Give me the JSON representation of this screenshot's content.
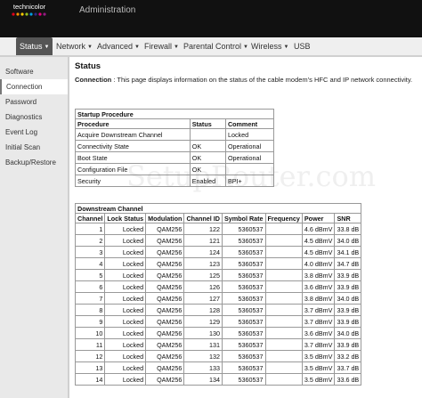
{
  "brand": {
    "logo_text": "technicolor",
    "watermark": "SetupRouter.com"
  },
  "header": {
    "title": "Administration"
  },
  "nav": {
    "items": [
      {
        "label": "Status",
        "caret": true
      },
      {
        "label": "Network",
        "caret": true
      },
      {
        "label": "Advanced",
        "caret": true
      },
      {
        "label": "Firewall",
        "caret": true
      },
      {
        "label": "Parental Control",
        "caret": true
      },
      {
        "label": "Wireless",
        "caret": true
      },
      {
        "label": "USB",
        "caret": false
      }
    ]
  },
  "sidebar": {
    "items": [
      "Software",
      "Connection",
      "Password",
      "Diagnostics",
      "Event Log",
      "Initial Scan",
      "Backup/Restore"
    ]
  },
  "main": {
    "title": "Status",
    "desc_label": "Connection",
    "desc_sep": ":",
    "desc_text": "This page displays information on the status of the cable modem's HFC and IP network connectivity."
  },
  "startup": {
    "caption": "Startup Procedure",
    "headers": [
      "Procedure",
      "Status",
      "Comment"
    ],
    "rows": [
      [
        "Acquire Downstream Channel",
        "",
        "Locked"
      ],
      [
        "Connectivity State",
        "OK",
        "Operational"
      ],
      [
        "Boot State",
        "OK",
        "Operational"
      ],
      [
        "Configuration File",
        "OK",
        ""
      ],
      [
        "Security",
        "Enabled",
        "BPI+"
      ]
    ]
  },
  "downstream": {
    "caption": "Downstream Channel",
    "headers": [
      "Channel",
      "Lock Status",
      "Modulation",
      "Channel ID",
      "Symbol Rate",
      "Frequency",
      "Power",
      "SNR"
    ],
    "rows": [
      [
        "1",
        "Locked",
        "QAM256",
        "122",
        "5360537",
        "",
        "4.6 dBmV",
        "33.8 dB"
      ],
      [
        "2",
        "Locked",
        "QAM256",
        "121",
        "5360537",
        "",
        "4.5 dBmV",
        "34.0 dB"
      ],
      [
        "3",
        "Locked",
        "QAM256",
        "124",
        "5360537",
        "",
        "4.5 dBmV",
        "34.1 dB"
      ],
      [
        "4",
        "Locked",
        "QAM256",
        "123",
        "5360537",
        "",
        "4.0 dBmV",
        "34.7 dB"
      ],
      [
        "5",
        "Locked",
        "QAM256",
        "125",
        "5360537",
        "",
        "3.8 dBmV",
        "33.9 dB"
      ],
      [
        "6",
        "Locked",
        "QAM256",
        "126",
        "5360537",
        "",
        "3.6 dBmV",
        "33.9 dB"
      ],
      [
        "7",
        "Locked",
        "QAM256",
        "127",
        "5360537",
        "",
        "3.8 dBmV",
        "34.0 dB"
      ],
      [
        "8",
        "Locked",
        "QAM256",
        "128",
        "5360537",
        "",
        "3.7 dBmV",
        "33.9 dB"
      ],
      [
        "9",
        "Locked",
        "QAM256",
        "129",
        "5360537",
        "",
        "3.7 dBmV",
        "33.9 dB"
      ],
      [
        "10",
        "Locked",
        "QAM256",
        "130",
        "5360537",
        "",
        "3.6 dBmV",
        "34.0 dB"
      ],
      [
        "11",
        "Locked",
        "QAM256",
        "131",
        "5360537",
        "",
        "3.7 dBmV",
        "33.9 dB"
      ],
      [
        "12",
        "Locked",
        "QAM256",
        "132",
        "5360537",
        "",
        "3.5 dBmV",
        "33.2 dB"
      ],
      [
        "13",
        "Locked",
        "QAM256",
        "133",
        "5360537",
        "",
        "3.5 dBmV",
        "33.7 dB"
      ],
      [
        "14",
        "Locked",
        "QAM256",
        "134",
        "5360537",
        "",
        "3.5 dBmV",
        "33.6 dB"
      ]
    ]
  }
}
